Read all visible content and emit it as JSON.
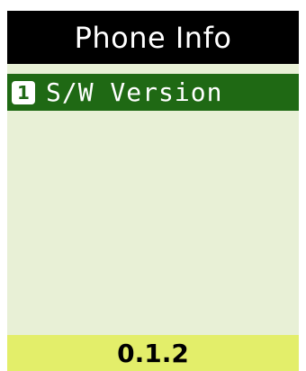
{
  "header": {
    "title": "Phone Info"
  },
  "menu": {
    "items": [
      {
        "number": "1",
        "label": "S/W Version",
        "selected": true
      }
    ]
  },
  "softkey": {
    "label": "0.1.2"
  },
  "colors": {
    "title_bg": "#000000",
    "content_bg": "#e8f0d6",
    "selection_bg": "#1f6914",
    "softkey_bg": "#e3ee6a"
  }
}
